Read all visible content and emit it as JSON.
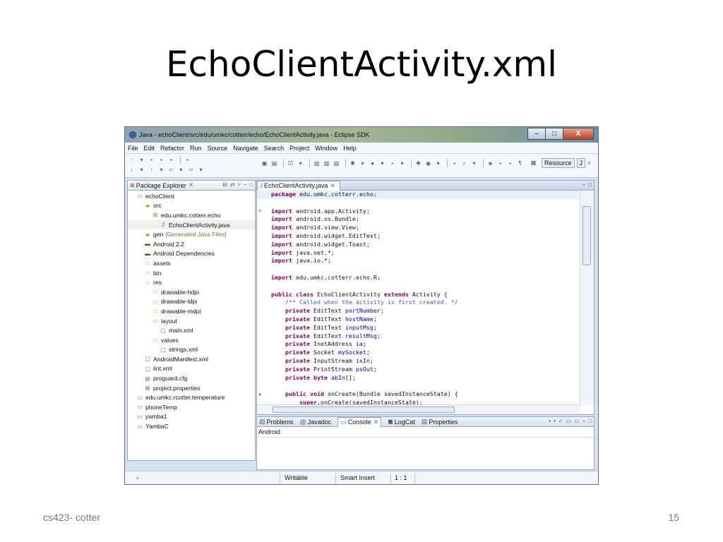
{
  "slide": {
    "title": "EchoClientActivity.xml",
    "footer_left": "cs423- cotter",
    "page_number": "15"
  },
  "window": {
    "title": "Java - echoClient/src/edu/umkc/cotterr/echo/EchoClientActivity.java - Eclipse SDK",
    "buttons": {
      "minimize": "–",
      "maximize": "□",
      "close": "X"
    }
  },
  "menu": [
    "File",
    "Edit",
    "Refactor",
    "Run",
    "Source",
    "Navigate",
    "Search",
    "Project",
    "Window",
    "Help"
  ],
  "toolbar": {
    "perspective_label": "Resource"
  },
  "package_explorer": {
    "tab_label": "Package Explorer",
    "tree": [
      {
        "label": "echoClient",
        "depth": 0,
        "icon": "project-icon"
      },
      {
        "label": "src",
        "depth": 1,
        "icon": "source-folder-icon"
      },
      {
        "label": "edu.umkc.cotterr.echo",
        "depth": 2,
        "icon": "package-icon"
      },
      {
        "label": "EchoClientActivity.java",
        "depth": 3,
        "icon": "java-file-icon"
      },
      {
        "label": "gen",
        "depth": 1,
        "icon": "source-folder-icon",
        "suffix": "[Generated Java Files]"
      },
      {
        "label": "Android 2.2",
        "depth": 1,
        "icon": "library-icon"
      },
      {
        "label": "Android Dependencies",
        "depth": 1,
        "icon": "library-icon"
      },
      {
        "label": "assets",
        "depth": 1,
        "icon": "folder-icon"
      },
      {
        "label": "bin",
        "depth": 1,
        "icon": "folder-icon"
      },
      {
        "label": "res",
        "depth": 1,
        "icon": "folder-icon"
      },
      {
        "label": "drawable-hdpi",
        "depth": 2,
        "icon": "folder-icon"
      },
      {
        "label": "drawable-ldpi",
        "depth": 2,
        "icon": "folder-icon"
      },
      {
        "label": "drawable-mdpi",
        "depth": 2,
        "icon": "folder-icon"
      },
      {
        "label": "layout",
        "depth": 2,
        "icon": "folder-icon"
      },
      {
        "label": "main.xml",
        "depth": 3,
        "icon": "xml-file-icon"
      },
      {
        "label": "values",
        "depth": 2,
        "icon": "folder-icon"
      },
      {
        "label": "strings.xml",
        "depth": 3,
        "icon": "xml-file-icon"
      },
      {
        "label": "AndroidManifest.xml",
        "depth": 1,
        "icon": "xml-file-icon"
      },
      {
        "label": "lint.xml",
        "depth": 1,
        "icon": "xml-file-icon"
      },
      {
        "label": "proguard.cfg",
        "depth": 1,
        "icon": "file-icon"
      },
      {
        "label": "project.properties",
        "depth": 1,
        "icon": "file-icon"
      },
      {
        "label": "edu.umkc.rcotter.temperature",
        "depth": 0,
        "icon": "project-icon"
      },
      {
        "label": "phoneTemp",
        "depth": 0,
        "icon": "project-icon"
      },
      {
        "label": "yamba1",
        "depth": 0,
        "icon": "project-icon"
      },
      {
        "label": "YambaC",
        "depth": 0,
        "icon": "project-icon"
      }
    ]
  },
  "editor": {
    "tab_label": "EchoClientActivity.java",
    "lines": [
      [
        {
          "t": "package",
          "c": "kw"
        },
        {
          "t": " edu.umkc.cotterr.echo;"
        }
      ],
      [],
      [
        {
          "t": "import",
          "c": "kw"
        },
        {
          "t": " android.app.Activity;"
        }
      ],
      [
        {
          "t": "import",
          "c": "kw"
        },
        {
          "t": " android.os.Bundle;"
        }
      ],
      [
        {
          "t": "import",
          "c": "kw"
        },
        {
          "t": " android.view.View;"
        }
      ],
      [
        {
          "t": "import",
          "c": "kw"
        },
        {
          "t": " android.widget.EditText;"
        }
      ],
      [
        {
          "t": "import",
          "c": "kw"
        },
        {
          "t": " android.widget.Toast;"
        }
      ],
      [
        {
          "t": "import",
          "c": "kw"
        },
        {
          "t": " java.net.*;"
        }
      ],
      [
        {
          "t": "import",
          "c": "kw"
        },
        {
          "t": " java.io.*;"
        }
      ],
      [],
      [
        {
          "t": "import",
          "c": "kw"
        },
        {
          "t": " edu.umkc.cotterr.echo.R;"
        }
      ],
      [],
      [
        {
          "t": "public",
          "c": "kw"
        },
        {
          "t": " "
        },
        {
          "t": "class",
          "c": "kw"
        },
        {
          "t": " EchoClientActivity "
        },
        {
          "t": "extends",
          "c": "kw"
        },
        {
          "t": " Activity {"
        }
      ],
      [
        {
          "t": "    "
        },
        {
          "t": "/** Called when the activity is first created. */",
          "c": "cm"
        }
      ],
      [
        {
          "t": "    "
        },
        {
          "t": "private",
          "c": "kw"
        },
        {
          "t": " EditText "
        },
        {
          "t": "portNumber",
          "c": "fld"
        },
        {
          "t": ";"
        }
      ],
      [
        {
          "t": "    "
        },
        {
          "t": "private",
          "c": "kw"
        },
        {
          "t": " EditText "
        },
        {
          "t": "hostName",
          "c": "fld"
        },
        {
          "t": ";"
        }
      ],
      [
        {
          "t": "    "
        },
        {
          "t": "private",
          "c": "kw"
        },
        {
          "t": " EditText "
        },
        {
          "t": "inputMsg",
          "c": "fld"
        },
        {
          "t": ";"
        }
      ],
      [
        {
          "t": "    "
        },
        {
          "t": "private",
          "c": "kw"
        },
        {
          "t": " EditText "
        },
        {
          "t": "resultMsg",
          "c": "fld"
        },
        {
          "t": ";"
        }
      ],
      [
        {
          "t": "    "
        },
        {
          "t": "private",
          "c": "kw"
        },
        {
          "t": " InetAddress "
        },
        {
          "t": "ia",
          "c": "fld"
        },
        {
          "t": ";"
        }
      ],
      [
        {
          "t": "    "
        },
        {
          "t": "private",
          "c": "kw"
        },
        {
          "t": " Socket "
        },
        {
          "t": "mySocket",
          "c": "fld"
        },
        {
          "t": ";"
        }
      ],
      [
        {
          "t": "    "
        },
        {
          "t": "private",
          "c": "kw"
        },
        {
          "t": " InputStream "
        },
        {
          "t": "isIn",
          "c": "fld"
        },
        {
          "t": ";"
        }
      ],
      [
        {
          "t": "    "
        },
        {
          "t": "private",
          "c": "kw"
        },
        {
          "t": " PrintStream "
        },
        {
          "t": "psOut",
          "c": "fld"
        },
        {
          "t": ";"
        }
      ],
      [
        {
          "t": "    "
        },
        {
          "t": "private",
          "c": "kw"
        },
        {
          "t": " "
        },
        {
          "t": "byte",
          "c": "kw"
        },
        {
          "t": " "
        },
        {
          "t": "abIn",
          "c": "fld"
        },
        {
          "t": "[];"
        }
      ],
      [],
      [
        {
          "t": "    "
        },
        {
          "t": "public",
          "c": "kw"
        },
        {
          "t": " "
        },
        {
          "t": "void",
          "c": "kw"
        },
        {
          "t": " onCreate(Bundle savedInstanceState) {"
        }
      ],
      [
        {
          "t": "        "
        },
        {
          "t": "super",
          "c": "kw"
        },
        {
          "t": ".onCreate(savedInstanceState);"
        }
      ]
    ]
  },
  "console": {
    "tabs": [
      "Problems",
      "Javadoc",
      "Console",
      "LogCat",
      "Properties"
    ],
    "active_tab": "Console",
    "label": "Android"
  },
  "status_bar": {
    "mode": "Writable",
    "insert": "Smart Insert",
    "position": "1 : 1"
  }
}
